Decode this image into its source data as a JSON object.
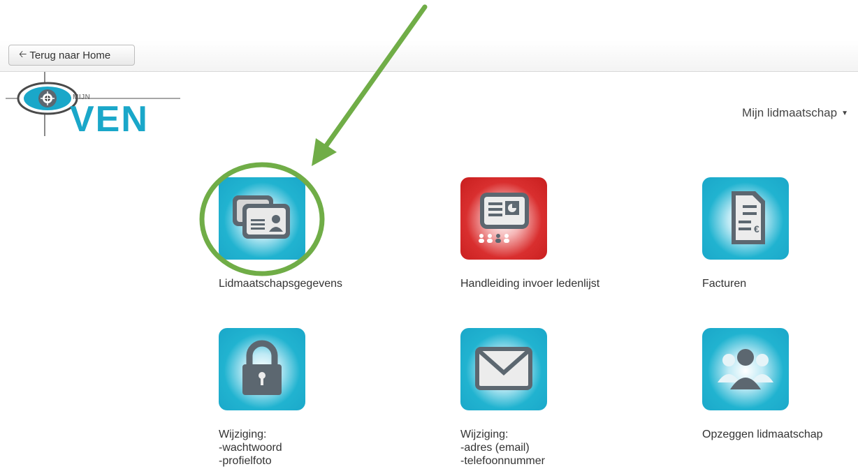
{
  "toolbar": {
    "back_label": "Terug naar Home",
    "back_icon": "arrow-left-icon"
  },
  "logo": {
    "small_text": "MIJN",
    "big_text": "VEN"
  },
  "account_menu": {
    "label": "Mijn lidmaatschap",
    "icon": "caret-down-icon"
  },
  "tiles": [
    {
      "label": "Lidmaatschapsgegevens",
      "icon": "id-cards-icon",
      "color": "#1aa7c9"
    },
    {
      "label": "Handleiding invoer ledenlijst",
      "icon": "presentation-icon",
      "color": "#d92f2f"
    },
    {
      "label": "Facturen",
      "icon": "invoice-icon",
      "color": "#1aa7c9"
    },
    {
      "label_lines": [
        "Wijziging:",
        "-wachtwoord",
        "-profielfoto"
      ],
      "icon": "lock-icon",
      "color": "#1aa7c9"
    },
    {
      "label_lines": [
        "Wijziging:",
        "-adres (email)",
        "-telefoonnummer"
      ],
      "icon": "envelope-icon",
      "color": "#1aa7c9"
    },
    {
      "label": "Opzeggen lidmaatschap",
      "icon": "users-icon",
      "color": "#1aa7c9"
    }
  ],
  "annotation": {
    "color": "#70ad47"
  }
}
